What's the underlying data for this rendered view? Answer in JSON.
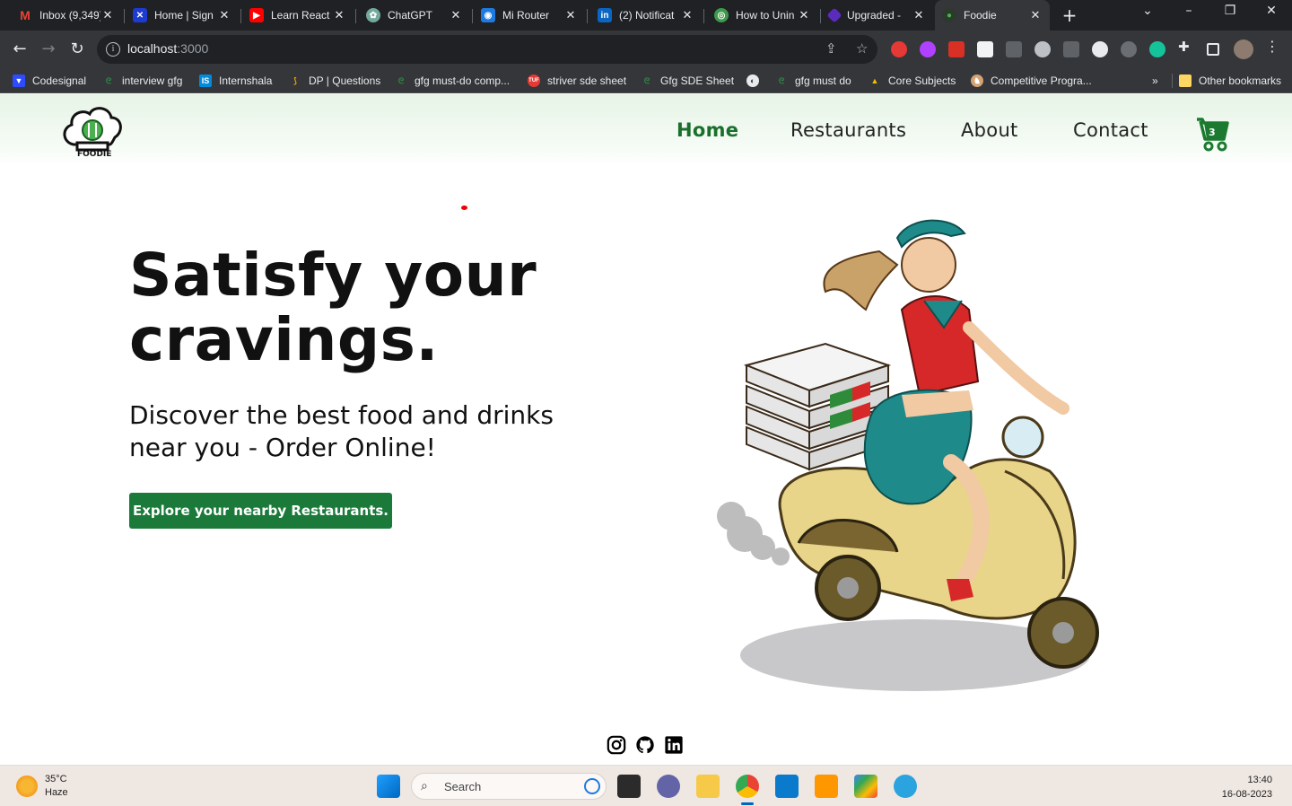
{
  "browser": {
    "tabs": [
      {
        "title": "Inbox (9,349)",
        "icon": "gmail-icon",
        "color": "#ea4335"
      },
      {
        "title": "Home | Sign",
        "icon": "workspace-icon",
        "color": "#2f5cff"
      },
      {
        "title": "Learn React",
        "icon": "youtube-icon",
        "color": "#ff0000"
      },
      {
        "title": "ChatGPT",
        "icon": "chatgpt-icon",
        "color": "#74aa9c"
      },
      {
        "title": "Mi Router",
        "icon": "wifi-icon",
        "color": "#1f7ae0"
      },
      {
        "title": "(2) Notificat",
        "icon": "linkedin-icon",
        "color": "#0a66c2"
      },
      {
        "title": "How to Unin",
        "icon": "site-icon",
        "color": "#3c9b4a"
      },
      {
        "title": "Upgraded -",
        "icon": "upgraded-icon",
        "color": "#5b2bbd"
      },
      {
        "title": "Foodie",
        "icon": "foodie-icon",
        "color": "#2c8a3a"
      }
    ],
    "active_tab": "Foodie",
    "url_host": "localhost",
    "url_port": ":3000",
    "bookmarks": [
      {
        "label": "Codesignal",
        "color": "#2e4cff"
      },
      {
        "label": "interview gfg",
        "color": "#2f8d46"
      },
      {
        "label": "Internshala",
        "color": "#008bdc"
      },
      {
        "label": "DP | Questions",
        "color": "#f4a300"
      },
      {
        "label": "gfg must-do comp...",
        "color": "#2f8d46"
      },
      {
        "label": "striver sde sheet",
        "color": "#e53935"
      },
      {
        "label": "Gfg SDE Sheet",
        "color": "#2f8d46"
      },
      {
        "label": "",
        "color": "#e8eaed"
      },
      {
        "label": "gfg must do",
        "color": "#2f8d46"
      },
      {
        "label": "Core Subjects",
        "color": "#fbbc04"
      },
      {
        "label": "Competitive Progra...",
        "color": "#d4a373"
      }
    ],
    "other_bookmarks": "Other bookmarks",
    "more_bookmarks": "»"
  },
  "site": {
    "logo_text": "FOODIE",
    "nav": [
      "Home",
      "Restaurants",
      "About",
      "Contact"
    ],
    "active_nav": "Home",
    "cart_count": "3",
    "hero_title": "Satisfy your cravings.",
    "hero_subtitle": "Discover the best food and drinks near you - Order Online!",
    "cta_label": "Explore your nearby Restaurants.",
    "socials": [
      "instagram-icon",
      "github-icon",
      "linkedin-icon"
    ],
    "accent_color": "#1b7a3a"
  },
  "taskbar": {
    "temperature": "35°C",
    "weather": "Haze",
    "search_placeholder": "Search",
    "time": "13:40",
    "date": "16-08-2023"
  }
}
